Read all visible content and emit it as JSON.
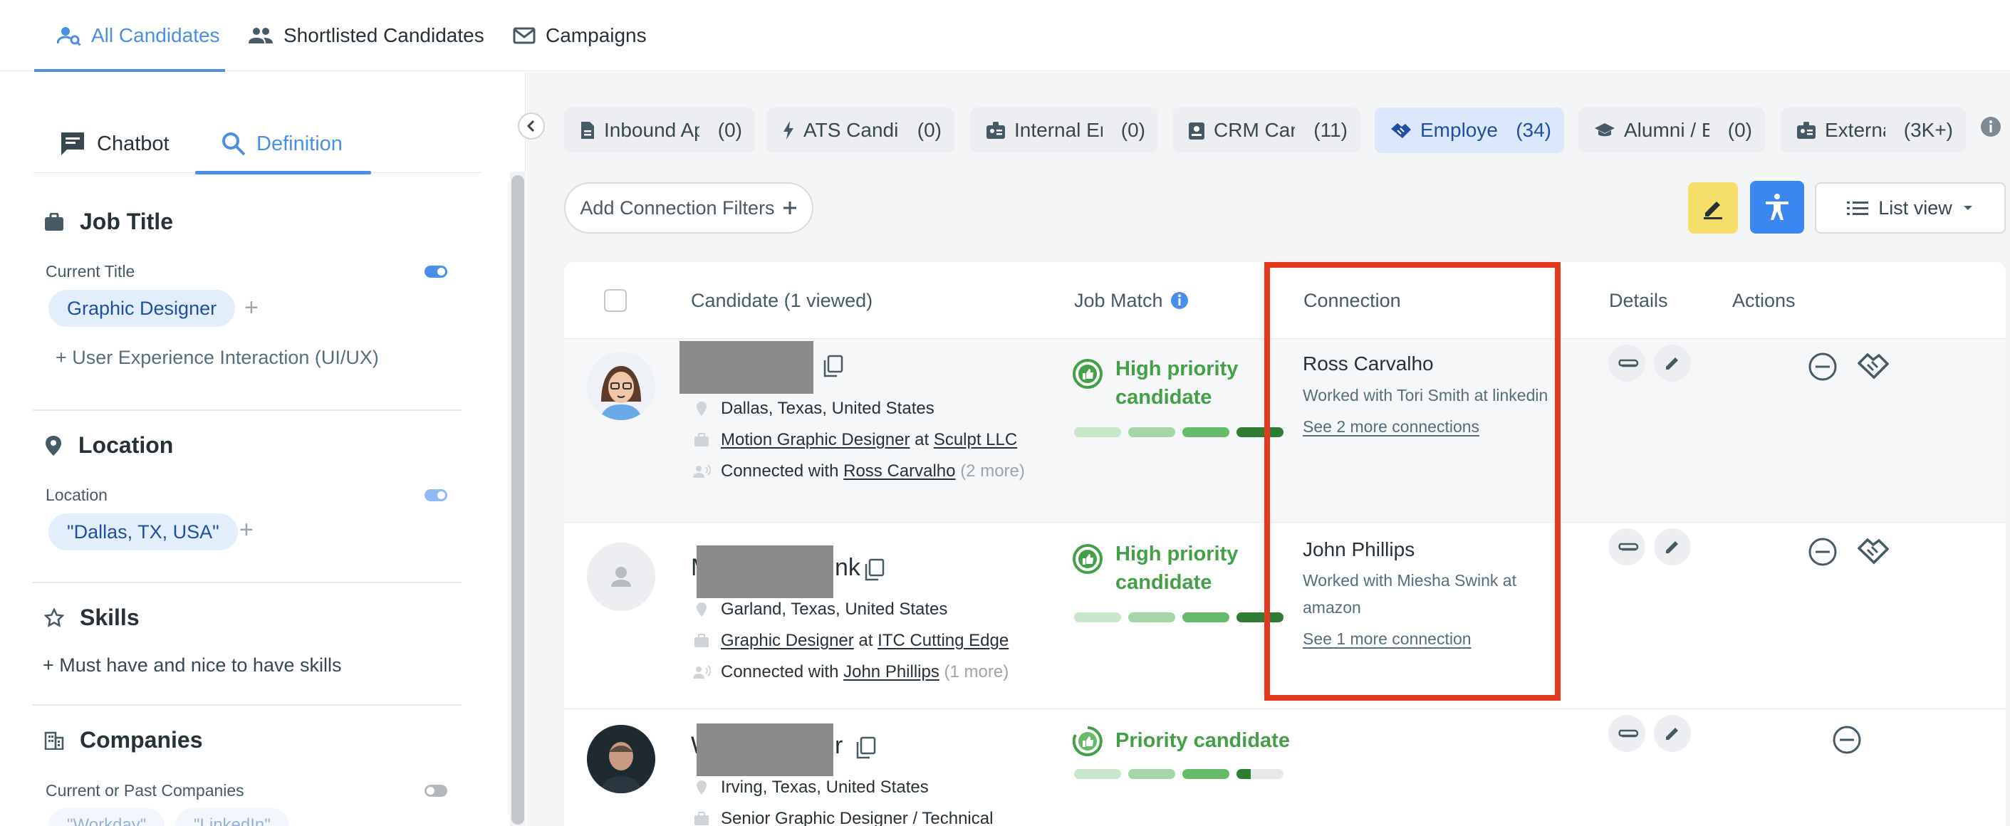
{
  "topnav": {
    "tabs": [
      {
        "label": "All Candidates",
        "active": true
      },
      {
        "label": "Shortlisted Candidates",
        "active": false
      },
      {
        "label": "Campaigns",
        "active": false
      }
    ]
  },
  "left_panel": {
    "tabs": [
      {
        "label": "Chatbot",
        "active": false
      },
      {
        "label": "Definition",
        "active": true
      }
    ],
    "job_title": {
      "title": "Job Title",
      "field_label": "Current Title",
      "chip": "Graphic Designer",
      "suggestion": "+ User Experience Interaction (UI/UX)"
    },
    "location": {
      "title": "Location",
      "field_label": "Location",
      "chip": "\"Dallas, TX, USA\""
    },
    "skills": {
      "title": "Skills",
      "add_label": "+ Must have and nice to have skills"
    },
    "companies": {
      "title": "Companies",
      "field_label": "Current or Past Companies",
      "chips": [
        "\"Workday\"",
        "\"LinkedIn\""
      ]
    }
  },
  "source_tabs": [
    {
      "label": "Inbound Ap",
      "count": "(0)",
      "icon": "document-icon",
      "active": false
    },
    {
      "label": "ATS Candid",
      "count": "(0)",
      "icon": "bolt-icon",
      "active": false
    },
    {
      "label": "Internal Em",
      "count": "(0)",
      "icon": "badge-icon",
      "active": false
    },
    {
      "label": "CRM Cand",
      "count": "(11)",
      "icon": "contact-card-icon",
      "active": false
    },
    {
      "label": "Employee",
      "count": "(34)",
      "icon": "handshake-icon",
      "active": true
    },
    {
      "label": "Alumni / Bo",
      "count": "(0)",
      "icon": "graduation-cap-icon",
      "active": false
    },
    {
      "label": "External",
      "count": "(3K+)",
      "icon": "id-badge-icon",
      "active": false
    }
  ],
  "toolbar": {
    "add_filter_label": "Add Connection Filters",
    "view_label": "List view"
  },
  "table": {
    "headers": {
      "candidate": "Candidate (1 viewed)",
      "job_match": "Job Match",
      "connection": "Connection",
      "details": "Details",
      "actions": "Actions"
    },
    "rows": [
      {
        "name_visible": "",
        "location": "Dallas, Texas, United States",
        "role": "Motion Graphic Designer",
        "role_at": "at",
        "company": "Sculpt LLC",
        "connected_prefix": "Connected with",
        "connected_name": "Ross Carvalho",
        "connected_more": "(2 more)",
        "priority": "High priority candidate",
        "priority_line1": "High priority",
        "priority_line2": "candidate",
        "conn_name": "Ross Carvalho",
        "conn_desc": "Worked with Tori Smith at linkedin",
        "conn_more": "See 2 more connections"
      },
      {
        "name_visible_start": "M",
        "name_visible_end": "nk",
        "location": "Garland, Texas, United States",
        "role": "Graphic Designer",
        "role_at": "at",
        "company": "ITC Cutting Edge",
        "connected_prefix": "Connected with",
        "connected_name": "John Phillips",
        "connected_more": "(1 more)",
        "priority_line1": "High priority",
        "priority_line2": "candidate",
        "conn_name": "John Phillips",
        "conn_desc": "Worked with Miesha Swink at amazon",
        "conn_more": "See 1 more connection"
      },
      {
        "name_visible_start": "W",
        "name_visible_end": "r",
        "location": "Irving, Texas, United States",
        "role_prefix": "Senior",
        "role": "Graphic Designer",
        "role_suffix": "/ Technical",
        "priority_line1": "Priority candidate"
      }
    ]
  },
  "colors": {
    "accent": "#4a8fe7",
    "priority_green": "#43a047",
    "highlight_red": "#e5391f",
    "yellow_button": "#f7de6b",
    "blue_button": "#3a87f2"
  }
}
